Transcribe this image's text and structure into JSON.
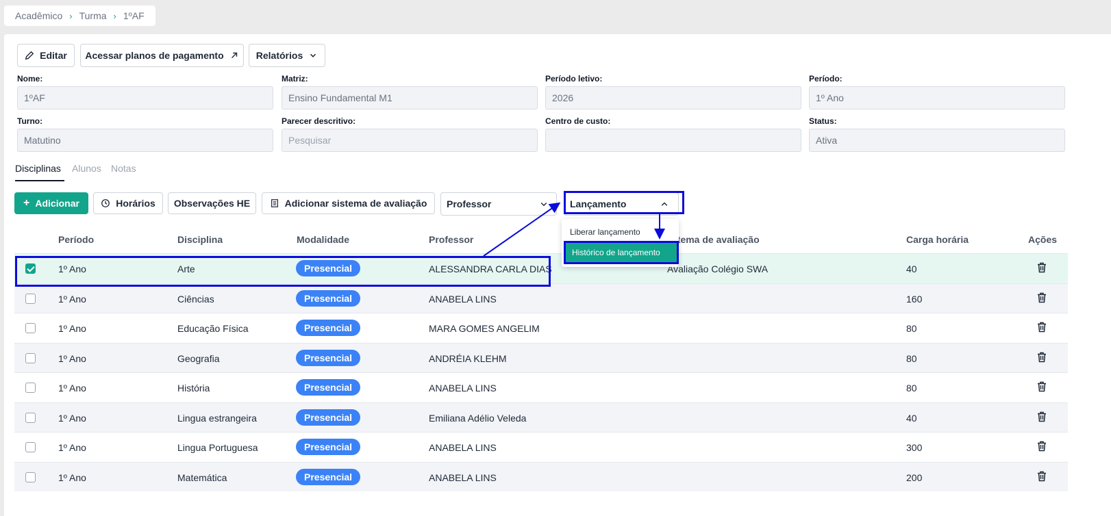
{
  "breadcrumb": [
    "Acadêmico",
    "Turma",
    "1ºAF"
  ],
  "toolbar": {
    "edit": "Editar",
    "payment_plans": "Acessar planos de pagamento",
    "reports": "Relatórios"
  },
  "fields": [
    {
      "label": "Nome:",
      "value": "1ºAF",
      "placeholder": false
    },
    {
      "label": "Matriz:",
      "value": "Ensino Fundamental M1",
      "placeholder": false
    },
    {
      "label": "Período letivo:",
      "value": "2026",
      "placeholder": false
    },
    {
      "label": "Período:",
      "value": "1º Ano",
      "placeholder": false
    },
    {
      "label": "Turno:",
      "value": "Matutino",
      "placeholder": false
    },
    {
      "label": "Parecer descritivo:",
      "value": "Pesquisar",
      "placeholder": true
    },
    {
      "label": "Centro de custo:",
      "value": "",
      "placeholder": false
    },
    {
      "label": "Status:",
      "value": "Ativa",
      "placeholder": false
    }
  ],
  "tabs": [
    "Disciplinas",
    "Alunos",
    "Notas"
  ],
  "actions": {
    "add": "Adicionar",
    "schedules": "Horários",
    "obs": "Observações HE",
    "add_eval": "Adicionar sistema de avaliação",
    "teacher_select": "Professor",
    "launch_select": "Lançamento"
  },
  "dropdown": [
    "Liberar lançamento",
    "Histórico de lançamento"
  ],
  "table": {
    "headers": [
      "Período",
      "Disciplina",
      "Modalidade",
      "Professor",
      "stema de avaliação",
      "Carga horária",
      "Ações"
    ],
    "rows": [
      {
        "periodo": "1º Ano",
        "disciplina": "Arte",
        "modalidade": "Presencial",
        "professor": "ALESSANDRA CARLA DIAS",
        "avaliacao": "Avaliação Colégio SWA",
        "carga": "40",
        "checked": true
      },
      {
        "periodo": "1º Ano",
        "disciplina": "Ciências",
        "modalidade": "Presencial",
        "professor": "ANABELA LINS",
        "avaliacao": "",
        "carga": "160",
        "checked": false
      },
      {
        "periodo": "1º Ano",
        "disciplina": "Educação Física",
        "modalidade": "Presencial",
        "professor": "MARA GOMES ANGELIM",
        "avaliacao": "",
        "carga": "80",
        "checked": false
      },
      {
        "periodo": "1º Ano",
        "disciplina": "Geografia",
        "modalidade": "Presencial",
        "professor": "ANDRÉIA KLEHM",
        "avaliacao": "",
        "carga": "80",
        "checked": false
      },
      {
        "periodo": "1º Ano",
        "disciplina": "História",
        "modalidade": "Presencial",
        "professor": "ANABELA LINS",
        "avaliacao": "",
        "carga": "80",
        "checked": false
      },
      {
        "periodo": "1º Ano",
        "disciplina": "Lingua estrangeira",
        "modalidade": "Presencial",
        "professor": "Emiliana Adélio Veleda",
        "avaliacao": "",
        "carga": "40",
        "checked": false
      },
      {
        "periodo": "1º Ano",
        "disciplina": "Lingua Portuguesa",
        "modalidade": "Presencial",
        "professor": "ANABELA LINS",
        "avaliacao": "",
        "carga": "300",
        "checked": false
      },
      {
        "periodo": "1º Ano",
        "disciplina": "Matemática",
        "modalidade": "Presencial",
        "professor": "ANABELA LINS",
        "avaliacao": "",
        "carga": "200",
        "checked": false
      }
    ]
  },
  "colors": {
    "accent": "#12a58c",
    "badge": "#3b82f6",
    "annotation": "#0b0bdc"
  }
}
